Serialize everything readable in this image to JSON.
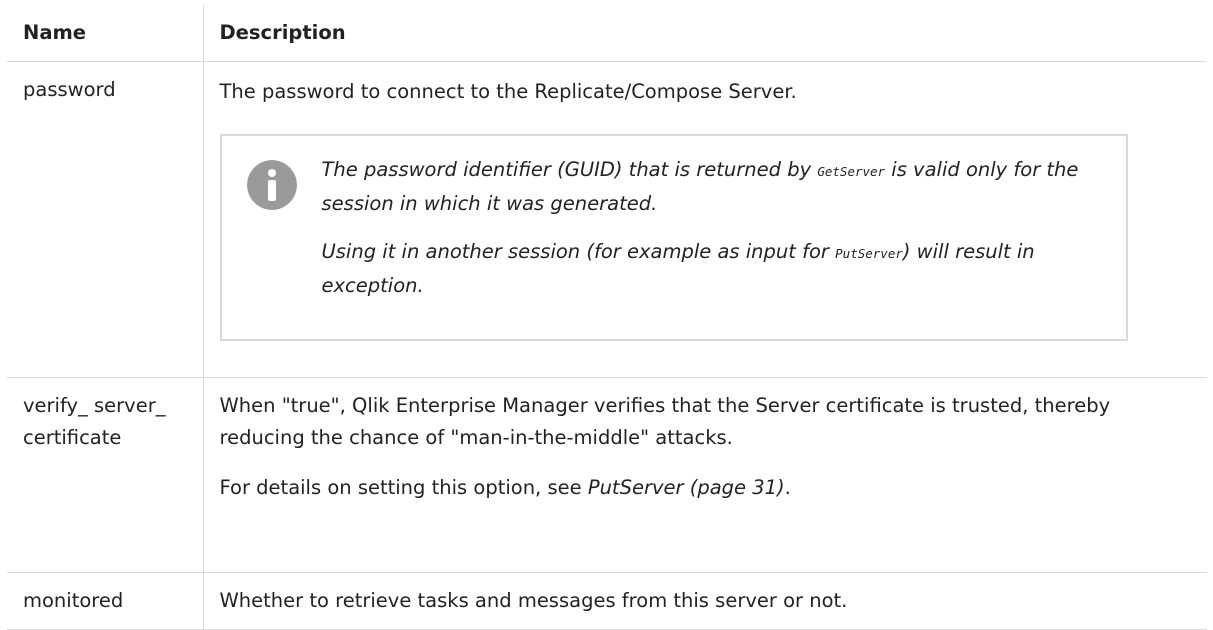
{
  "table": {
    "headers": {
      "name": "Name",
      "description": "Description"
    },
    "rows": [
      {
        "name": "password",
        "description": "The password to connect to the Replicate/Compose Server.",
        "note": {
          "icon": "info-icon",
          "p1_before": "The password identifier (GUID) that is returned by ",
          "p1_code": "GetServer",
          "p1_after": " is valid only for the session in which it was generated.",
          "p2_before": "Using it in another session (for example as input for ",
          "p2_code": "PutServer",
          "p2_after": ") will result in exception."
        }
      },
      {
        "name": "verify_ server_ certificate",
        "description": "When \"true\", Qlik Enterprise Manager verifies that the Server certificate is trusted, thereby reducing the chance of \"man-in-the-middle\" attacks.",
        "detail_before": "For details on setting this option, see ",
        "detail_link": "PutServer (page 31)",
        "detail_after": "."
      },
      {
        "name": "monitored",
        "description": "Whether to retrieve tasks and messages from this server or not."
      }
    ]
  }
}
